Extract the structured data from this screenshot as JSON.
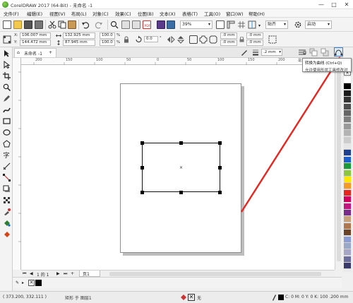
{
  "window": {
    "title": "CorelDRAW 2017 (64-Bit) - 未命名 -1",
    "minimize_glyph": "—",
    "restore_glyph": "□",
    "close_glyph": "✕"
  },
  "menu": {
    "items": [
      "文件(F)",
      "编辑(E)",
      "视图(V)",
      "布局(L)",
      "对象(C)",
      "效果(C)",
      "位图(B)",
      "文本(X)",
      "表格(T)",
      "工具(O)",
      "窗口(W)",
      "帮助(H)"
    ]
  },
  "standard_bar": {
    "zoom_value": "39%",
    "snap_label": "贴齐",
    "launch_label": "启动"
  },
  "property_bar": {
    "x_label": "X:",
    "x_value": "106.007 mm",
    "y_label": "Y:",
    "y_value": "144.472 mm",
    "w_value": "132.925 mm",
    "h_value": "87.945 mm",
    "scale_w": "100.0",
    "scale_h": "100.0",
    "pct_w": "%",
    "pct_h": "%",
    "angle_value": "0.0",
    "degree": "°",
    "corner_1": ".0 mm",
    "corner_2": ".0 mm",
    "corner_3": ".0 mm",
    "corner_4": ".0 mm",
    "outline_width": ".2 mm"
  },
  "tabs": {
    "document_tab": "未命名 -1"
  },
  "ruler": {
    "unit_label": "毫米",
    "top_ticks": [
      "200",
      "150",
      "100",
      "50",
      "0",
      "50",
      "100",
      "150",
      "200"
    ]
  },
  "navigator": {
    "page_counter": "1 的 1",
    "page_tab": "页1"
  },
  "status": {
    "coordinates": "( 373.200, 332.111 )",
    "object_info": "矩形 于 图层1",
    "fill_none": "无",
    "outline_info": "C: 0 M: 0 Y: 0 K: 100  .200 mm"
  },
  "tooltip": {
    "title": "转换为曲线 (Ctrl+Q)",
    "desc": "允许使用形状工具修改对"
  },
  "icons": [
    "app-logo-icon",
    "new-file-icon",
    "open-icon",
    "save-icon",
    "print-icon",
    "cut-icon",
    "copy-icon",
    "paste-icon",
    "undo-icon",
    "redo-icon",
    "search-icon",
    "import-icon",
    "export-icon",
    "pdf-icon",
    "fullscreen-icon",
    "options-icon",
    "lock-icon",
    "rotate-icon",
    "mirror-h-icon",
    "mirror-v-icon",
    "wrap-icon",
    "convert-to-curves-icon"
  ],
  "palette_colors": [
    "#ffffff",
    "#000000",
    "#1a1a1a",
    "#333333",
    "#4d4d4d",
    "#666666",
    "#808080",
    "#999999",
    "#b3b3b3",
    "#cccccc",
    "#e6e6e6",
    "#1f3f8f",
    "#1e5fd0",
    "#1a9b3b",
    "#8cc63f",
    "#ffe600",
    "#f59a23",
    "#e8251f",
    "#d40060",
    "#c2187e",
    "#7a2a8c",
    "#c8a27a",
    "#b07850",
    "#6b4226",
    "#8a9bd6",
    "#9aa8c8",
    "#a6a6c6",
    "#6c6c9c",
    "#3a3a6a"
  ],
  "accent_color": "#e8251f"
}
